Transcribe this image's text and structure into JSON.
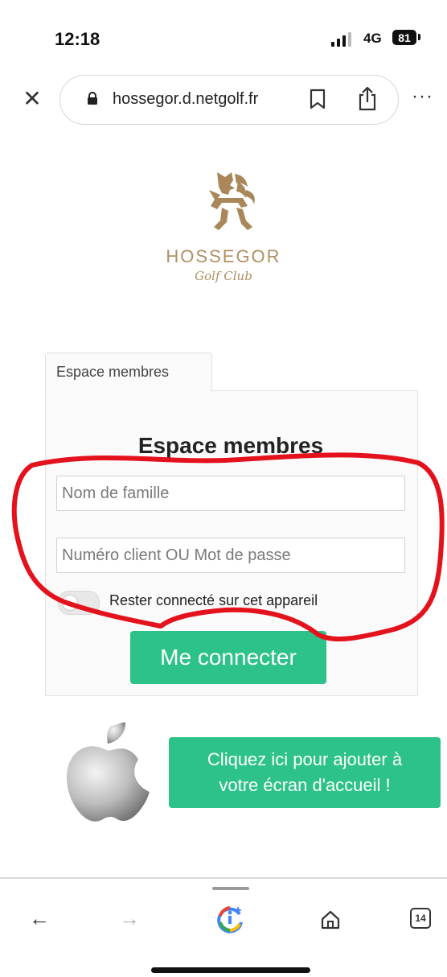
{
  "status_bar": {
    "time": "12:18",
    "network": "4G",
    "battery": "81"
  },
  "browser": {
    "url": "hossegor.d.netgolf.fr",
    "close_icon": "close-icon",
    "more_label": "···"
  },
  "logo": {
    "name": "HOSSEGOR",
    "subtitle": "Golf Club"
  },
  "login": {
    "tab_label": "Espace membres",
    "title": "Espace membres",
    "lastname_placeholder": "Nom de famille",
    "password_placeholder": "Numéro client OU Mot de passe",
    "remember_label": "Rester connecté sur cet appareil",
    "remember_checked": false,
    "submit_label": "Me connecter"
  },
  "home_screen": {
    "cta_line1": "Cliquez ici pour ajouter à",
    "cta_line2": "votre écran d'accueil !"
  },
  "toolbar": {
    "back_label": "←",
    "forward_label": "→",
    "tab_count": "14"
  },
  "colors": {
    "accent_green": "#2dc28a",
    "logo_gold": "#b08f62",
    "annotation_red": "#e3121c"
  }
}
